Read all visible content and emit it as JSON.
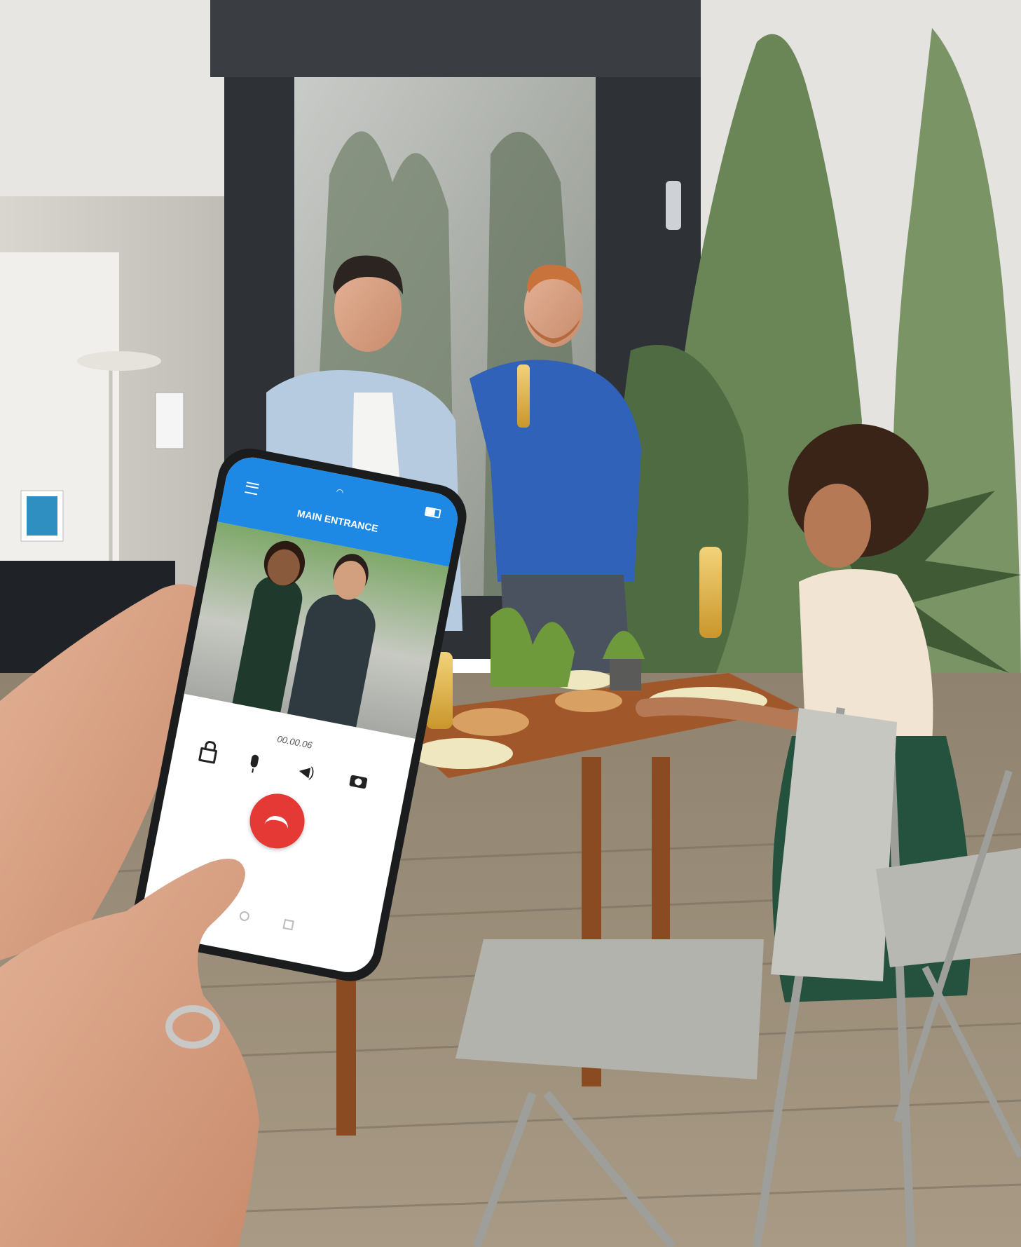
{
  "phone": {
    "title": "MAIN ENTRANCE",
    "timer": "00.00.06"
  },
  "colors": {
    "header_blue": "#1e88e5",
    "hangup_red": "#e53935",
    "deck_wood": "#9c8f7c",
    "wall_dark": "#3b3f44",
    "shirt_blue": "#2f62b8",
    "foliage": "#5d7a4c"
  },
  "icons": [
    "menu-icon",
    "wifi-icon",
    "battery-icon",
    "unlock-icon",
    "microphone-icon",
    "speaker-icon",
    "camera-icon",
    "hangup-icon",
    "home-nav-icon",
    "recents-nav-icon"
  ]
}
